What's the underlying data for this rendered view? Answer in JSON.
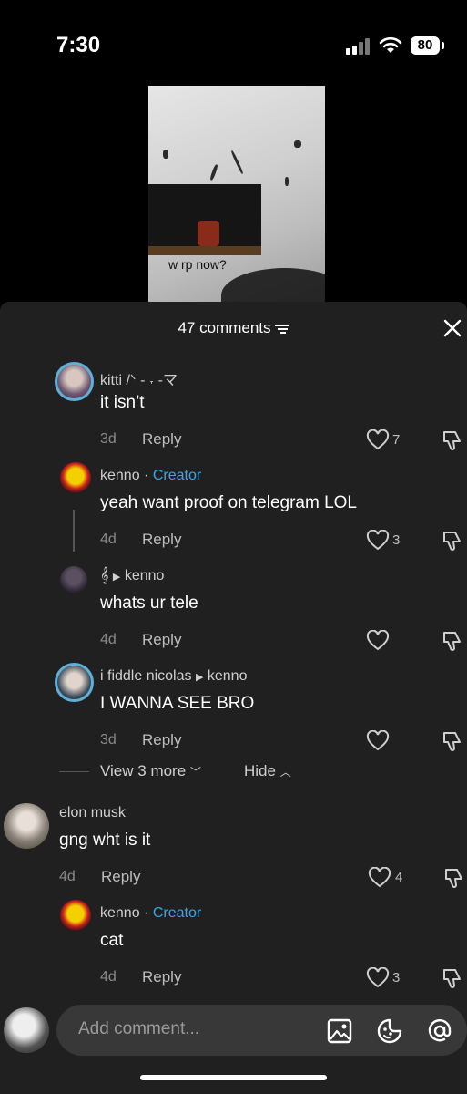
{
  "status_bar": {
    "time": "7:30",
    "battery": "80"
  },
  "video": {
    "caption": "w           rp now?"
  },
  "comments_header": {
    "count_label": "47 comments"
  },
  "comments": [
    {
      "user": "kitti /ᐠ - ˕ -マ",
      "text": "it isn’t",
      "age": "3d",
      "reply": "Reply",
      "likes": "7"
    },
    {
      "user": "kenno",
      "badge": "Creator",
      "text": "yeah want proof on telegram LOL",
      "age": "4d",
      "reply": "Reply",
      "likes": "3"
    },
    {
      "user": "𝄞",
      "reply_to": "kenno",
      "text": "whats ur tele",
      "age": "4d",
      "reply": "Reply",
      "likes": ""
    },
    {
      "user": "i fiddle nicolas",
      "reply_to": "kenno",
      "text": "I WANNA SEE BRO",
      "age": "3d",
      "reply": "Reply",
      "likes": ""
    },
    {
      "user": "elon musk",
      "text": "gng wht is it",
      "age": "4d",
      "reply": "Reply",
      "likes": "4"
    },
    {
      "user": "kenno",
      "badge": "Creator",
      "text": "cat",
      "age": "4d",
      "reply": "Reply",
      "likes": "3"
    }
  ],
  "thread_controls": {
    "view_more": "View 3 more",
    "hide": "Hide"
  },
  "composer": {
    "placeholder": "Add comment..."
  },
  "colors": {
    "sheet_bg": "#202020",
    "creator_blue": "#3aa6e8",
    "input_bg": "#383838"
  },
  "icons": {
    "header": [
      "sort-icon",
      "close-icon"
    ],
    "comment_actions": [
      "heart-icon",
      "dislike-icon"
    ],
    "composer": [
      "image-icon",
      "emoji-icon",
      "mention-icon"
    ]
  }
}
